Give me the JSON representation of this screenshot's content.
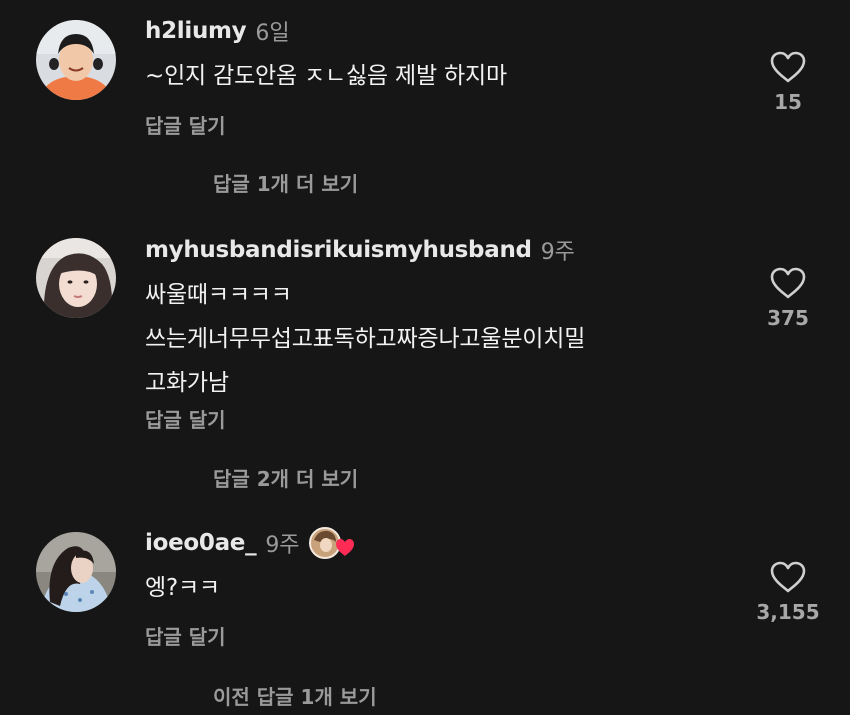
{
  "comments": [
    {
      "username": "h2liumy",
      "time": "6일",
      "text": "~인지 감도안옴 ㅈㄴ싫음 제발 하지마",
      "reply_label": "답글 달기",
      "likes": "15",
      "more_replies": "답글 1개 더 보기",
      "avatar": "avatar-photo-person-orange-shirt"
    },
    {
      "username": "myhusbandisrikuismyhusband",
      "time": "9주",
      "text": "싸울때ㅋㅋㅋㅋ\n쓰는게너무무섭고표독하고짜증나고울분이치밀\n고화가남",
      "reply_label": "답글 달기",
      "likes": "375",
      "more_replies": "답글 2개 더 보기",
      "avatar": "avatar-photo-selfie"
    },
    {
      "username": "ioeo0ae_",
      "time": "9주",
      "text": "엥?ㅋㅋ",
      "reply_label": "답글 달기",
      "likes": "3,155",
      "more_replies": "이전 답글 1개 보기",
      "avatar": "avatar-photo-side-profile",
      "badge": "creator-liked-heart-icon"
    }
  ],
  "colors": {
    "background": "#161616",
    "heart_badge": "#fe2c55",
    "secondary_text": "#9a9a9a"
  }
}
